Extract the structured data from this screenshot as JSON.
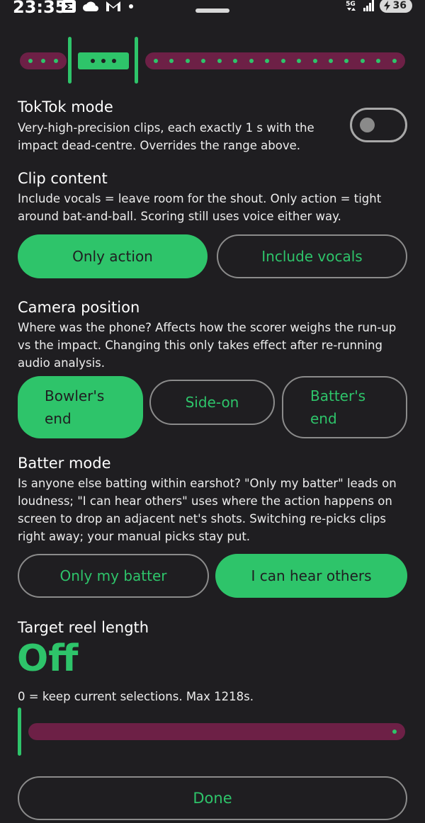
{
  "status_bar": {
    "time": "23:35",
    "battery": "36",
    "network": "5G"
  },
  "tiktok": {
    "title": "TokTok mode",
    "description": "Very-high-precision clips, each exactly 1 s with the impact dead-centre. Overrides the range above.",
    "enabled": false
  },
  "clip_content": {
    "title": "Clip content",
    "description": "Include vocals = leave room for the shout. Only action = tight around bat-and-ball. Scoring still uses voice either way.",
    "options": [
      "Only action",
      "Include vocals"
    ],
    "selected": "Only action"
  },
  "camera_position": {
    "title": "Camera position",
    "description": "Where was the phone? Affects how the scorer weighs the run-up vs the impact. Changing this only takes effect after re-running audio analysis.",
    "options": [
      "Bowler's\nend",
      "Side-on",
      "Batter's\nend"
    ],
    "selected": "Bowler's\nend"
  },
  "batter_mode": {
    "title": "Batter mode",
    "description": "Is anyone else batting within earshot? \"Only my batter\" leads on loudness; \"I can hear others\" uses where the action happens on screen to drop an adjacent net's shots. Switching re-picks clips right away; your manual picks stay put.",
    "options": [
      "Only my batter",
      "I can hear others"
    ],
    "selected": "I can hear others"
  },
  "target_reel": {
    "title": "Target reel length",
    "value": "Off",
    "hint": "0 = keep current selections. Max 1218s.",
    "slider_value": 0
  },
  "done_label": "Done",
  "colors": {
    "accent": "#2ec46a",
    "track": "#6d2046",
    "background": "#1f1e21"
  }
}
